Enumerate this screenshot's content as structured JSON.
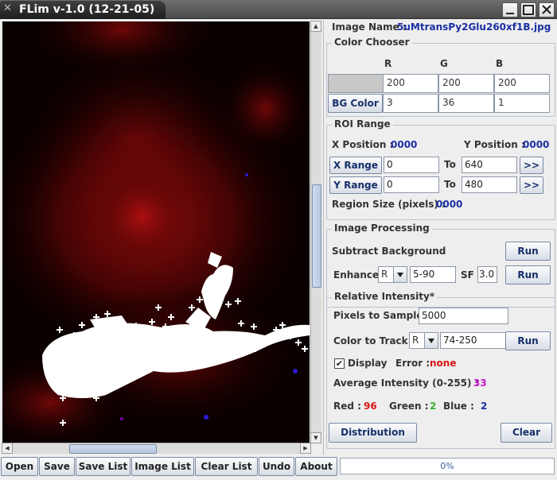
{
  "window": {
    "title": "FLim v-1.0 (12-21-05)"
  },
  "image_name": {
    "label": "Image Name :",
    "value": "5uMtransPy2Glu260xf1B.jpg"
  },
  "color_chooser": {
    "title": "Color Chooser",
    "headers": [
      "R",
      "G",
      "B"
    ],
    "swatch_row": [
      "200",
      "200",
      "200"
    ],
    "swatch_color": "#c8c8c8",
    "bg_button": "BG Color",
    "bg_row": [
      "3",
      "36",
      "1"
    ]
  },
  "roi_range": {
    "title": "ROI Range",
    "x_position_label": "X Position :",
    "x_position_value": "0000",
    "y_position_label": "Y Position :",
    "y_position_value": "0000",
    "x_range_button": "X Range",
    "x_from": "0",
    "x_to_label": "To",
    "x_to": "640",
    "y_range_button": "Y Range",
    "y_from": "0",
    "y_to_label": "To",
    "y_to": "480",
    "next_button": ">>",
    "region_size_label": "Region Size (pixels) :",
    "region_size_value": "0000"
  },
  "image_processing": {
    "title": "Image Processing",
    "subtract_label": "Subtract Background",
    "run_label": "Run",
    "enhance_label": "Enhance",
    "enhance_channel": "R",
    "enhance_range": "5-90",
    "sf_label": "SF",
    "sf_value": "3.0"
  },
  "relative_intensity": {
    "title": "Relative Intensity*",
    "pixels_label": "Pixels to Sample",
    "pixels_value": "5000",
    "track_label": "Color to Track",
    "track_channel": "R",
    "track_range": "74-250",
    "run_label": "Run",
    "display_checked": "✔",
    "display_label": "Display",
    "error_label": "Error :",
    "error_value": "none",
    "avg_label": "Average Intensity (0-255) :",
    "avg_value": "33",
    "red_label": "Red :",
    "red_value": "96",
    "green_label": "Green :",
    "green_value": "2",
    "blue_label": "Blue :",
    "blue_value": "2",
    "distribution_button": "Distribution",
    "clear_button": "Clear"
  },
  "toolbar": {
    "buttons": [
      "Open",
      "Save",
      "Save List",
      "Image List",
      "Clear List",
      "Undo",
      "About"
    ],
    "progress": "0%",
    "progress_fraction": 0
  },
  "colors": {
    "accent_blue": "#1a2fa3",
    "error_red": "#d81414",
    "green": "#31b331",
    "magenta": "#cc16cc"
  }
}
